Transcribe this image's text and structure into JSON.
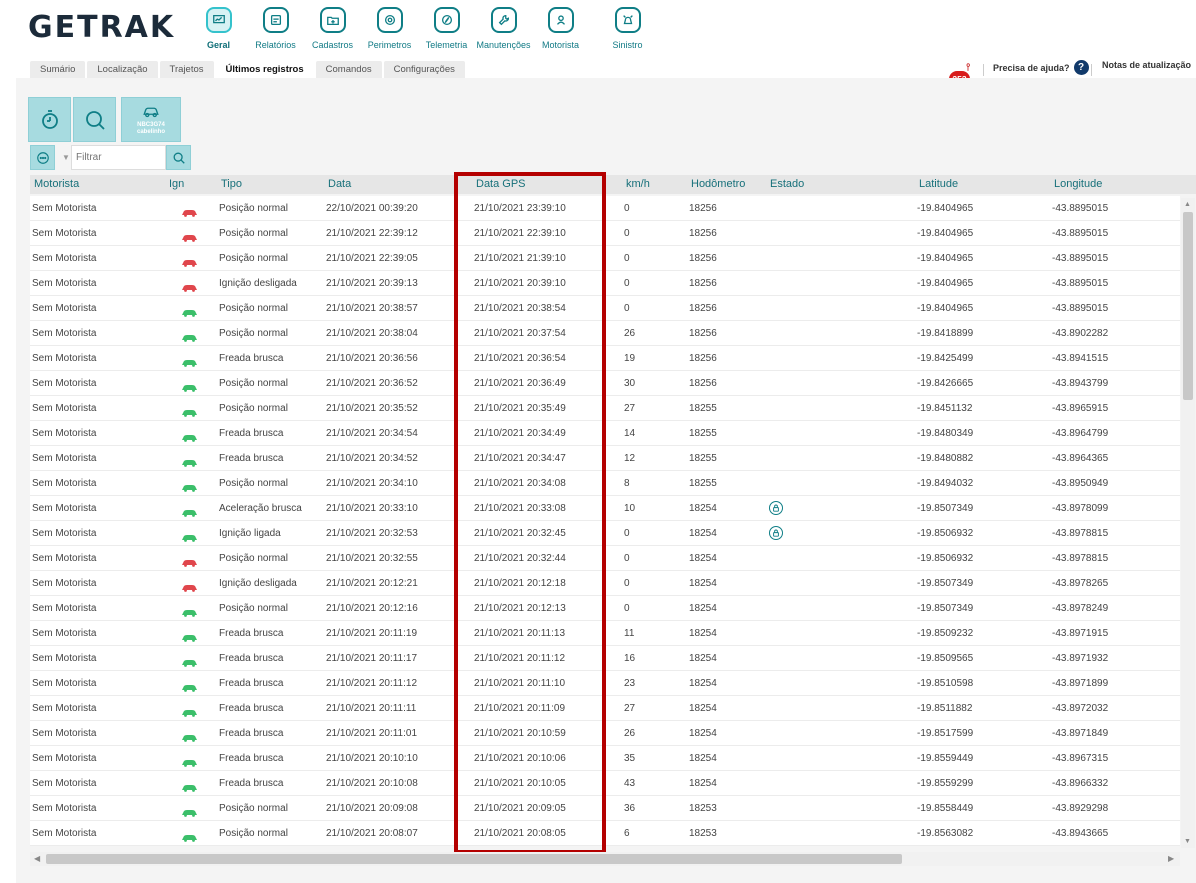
{
  "app": {
    "logo_text": "GETRAK"
  },
  "main_nav": [
    {
      "label": "Geral",
      "icon": "monitor-icon",
      "active": true
    },
    {
      "label": "Relatórios",
      "icon": "report-icon",
      "active": false
    },
    {
      "label": "Cadastros",
      "icon": "folder-plus-icon",
      "active": false
    },
    {
      "label": "Perimetros",
      "icon": "perimeter-icon",
      "active": false
    },
    {
      "label": "Telemetria",
      "icon": "compass-icon",
      "active": false
    },
    {
      "label": "Manutenções",
      "icon": "wrench-icon",
      "active": false
    },
    {
      "label": "Motorista",
      "icon": "driver-icon",
      "active": false
    },
    {
      "label": "Sinistro",
      "icon": "alarm-icon",
      "active": false
    }
  ],
  "sub_tabs": [
    {
      "label": "Sumário",
      "active": false
    },
    {
      "label": "Localização",
      "active": false
    },
    {
      "label": "Trajetos",
      "active": false
    },
    {
      "label": "Últimos registros",
      "active": true
    },
    {
      "label": "Comandos",
      "active": false
    },
    {
      "label": "Configurações",
      "active": false
    }
  ],
  "header_right": {
    "notifications_count": "253",
    "help_label": "Precisa de ajuda?",
    "help_icon_text": "?",
    "release_notes_label": "Notas de atualização"
  },
  "toolbar": {
    "vehicle_label_line1": "NBC3G74",
    "vehicle_label_line2": "cabelinho"
  },
  "filter": {
    "placeholder": "Filtrar"
  },
  "columns": {
    "motorista": "Motorista",
    "ign": "Ign",
    "tipo": "Tipo",
    "data": "Data",
    "data_gps": "Data GPS",
    "kmh": "km/h",
    "hodometro": "Hodômetro",
    "estado": "Estado",
    "latitude": "Latitude",
    "longitude": "Longitude"
  },
  "colors": {
    "ign_on": "#3bbf6a",
    "ign_off": "#e0464c",
    "accent": "#17707a",
    "highlight_box": "#b40000"
  },
  "rows": [
    {
      "motorista": "Sem Motorista",
      "ign": "off",
      "tipo": "Posição normal",
      "data": "22/10/2021 00:39:20",
      "data_gps": "21/10/2021 23:39:10",
      "kmh": "0",
      "hodometro": "18256",
      "estado": "",
      "latitude": "-19.8404965",
      "longitude": "-43.8895015",
      "trail": ""
    },
    {
      "motorista": "Sem Motorista",
      "ign": "off",
      "tipo": "Posição normal",
      "data": "21/10/2021 22:39:12",
      "data_gps": "21/10/2021 22:39:10",
      "kmh": "0",
      "hodometro": "18256",
      "estado": "",
      "latitude": "-19.8404965",
      "longitude": "-43.8895015",
      "trail": ""
    },
    {
      "motorista": "Sem Motorista",
      "ign": "off",
      "tipo": "Posição normal",
      "data": "21/10/2021 22:39:05",
      "data_gps": "21/10/2021 21:39:10",
      "kmh": "0",
      "hodometro": "18256",
      "estado": "",
      "latitude": "-19.8404965",
      "longitude": "-43.8895015",
      "trail": ""
    },
    {
      "motorista": "Sem Motorista",
      "ign": "off",
      "tipo": "Ignição desligada",
      "data": "21/10/2021 20:39:13",
      "data_gps": "21/10/2021 20:39:10",
      "kmh": "0",
      "hodometro": "18256",
      "estado": "",
      "latitude": "-19.8404965",
      "longitude": "-43.8895015",
      "trail": ""
    },
    {
      "motorista": "Sem Motorista",
      "ign": "on",
      "tipo": "Posição normal",
      "data": "21/10/2021 20:38:57",
      "data_gps": "21/10/2021 20:38:54",
      "kmh": "0",
      "hodometro": "18256",
      "estado": "",
      "latitude": "-19.8404965",
      "longitude": "-43.8895015",
      "trail": ""
    },
    {
      "motorista": "Sem Motorista",
      "ign": "on",
      "tipo": "Posição normal",
      "data": "21/10/2021 20:38:04",
      "data_gps": "21/10/2021 20:37:54",
      "kmh": "26",
      "hodometro": "18256",
      "estado": "",
      "latitude": "-19.8418899",
      "longitude": "-43.8902282",
      "trail": ""
    },
    {
      "motorista": "Sem Motorista",
      "ign": "on",
      "tipo": "Freada brusca",
      "data": "21/10/2021 20:36:56",
      "data_gps": "21/10/2021 20:36:54",
      "kmh": "19",
      "hodometro": "18256",
      "estado": "",
      "latitude": "-19.8425499",
      "longitude": "-43.8941515",
      "trail": ""
    },
    {
      "motorista": "Sem Motorista",
      "ign": "on",
      "tipo": "Posição normal",
      "data": "21/10/2021 20:36:52",
      "data_gps": "21/10/2021 20:36:49",
      "kmh": "30",
      "hodometro": "18256",
      "estado": "",
      "latitude": "-19.8426665",
      "longitude": "-43.8943799",
      "trail": ""
    },
    {
      "motorista": "Sem Motorista",
      "ign": "on",
      "tipo": "Posição normal",
      "data": "21/10/2021 20:35:52",
      "data_gps": "21/10/2021 20:35:49",
      "kmh": "27",
      "hodometro": "18255",
      "estado": "",
      "latitude": "-19.8451132",
      "longitude": "-43.8965915",
      "trail": ""
    },
    {
      "motorista": "Sem Motorista",
      "ign": "on",
      "tipo": "Freada brusca",
      "data": "21/10/2021 20:34:54",
      "data_gps": "21/10/2021 20:34:49",
      "kmh": "14",
      "hodometro": "18255",
      "estado": "",
      "latitude": "-19.8480349",
      "longitude": "-43.8964799",
      "trail": ""
    },
    {
      "motorista": "Sem Motorista",
      "ign": "on",
      "tipo": "Freada brusca",
      "data": "21/10/2021 20:34:52",
      "data_gps": "21/10/2021 20:34:47",
      "kmh": "12",
      "hodometro": "18255",
      "estado": "",
      "latitude": "-19.8480882",
      "longitude": "-43.8964365",
      "trail": ""
    },
    {
      "motorista": "Sem Motorista",
      "ign": "on",
      "tipo": "Posição normal",
      "data": "21/10/2021 20:34:10",
      "data_gps": "21/10/2021 20:34:08",
      "kmh": "8",
      "hodometro": "18255",
      "estado": "",
      "latitude": "-19.8494032",
      "longitude": "-43.8950949",
      "trail": ""
    },
    {
      "motorista": "Sem Motorista",
      "ign": "on",
      "tipo": "Aceleração brusca",
      "data": "21/10/2021 20:33:10",
      "data_gps": "21/10/2021 20:33:08",
      "kmh": "10",
      "hodometro": "18254",
      "estado": "lock-icon",
      "latitude": "-19.8507349",
      "longitude": "-43.8978099",
      "trail": ""
    },
    {
      "motorista": "Sem Motorista",
      "ign": "on",
      "tipo": "Ignição ligada",
      "data": "21/10/2021 20:32:53",
      "data_gps": "21/10/2021 20:32:45",
      "kmh": "0",
      "hodometro": "18254",
      "estado": "lock-icon",
      "latitude": "-19.8506932",
      "longitude": "-43.8978815",
      "trail": ""
    },
    {
      "motorista": "Sem Motorista",
      "ign": "off",
      "tipo": "Posição normal",
      "data": "21/10/2021 20:32:55",
      "data_gps": "21/10/2021 20:32:44",
      "kmh": "0",
      "hodometro": "18254",
      "estado": "",
      "latitude": "-19.8506932",
      "longitude": "-43.8978815",
      "trail": ""
    },
    {
      "motorista": "Sem Motorista",
      "ign": "off",
      "tipo": "Ignição desligada",
      "data": "21/10/2021 20:12:21",
      "data_gps": "21/10/2021 20:12:18",
      "kmh": "0",
      "hodometro": "18254",
      "estado": "",
      "latitude": "-19.8507349",
      "longitude": "-43.8978265",
      "trail": ""
    },
    {
      "motorista": "Sem Motorista",
      "ign": "on",
      "tipo": "Posição normal",
      "data": "21/10/2021 20:12:16",
      "data_gps": "21/10/2021 20:12:13",
      "kmh": "0",
      "hodometro": "18254",
      "estado": "",
      "latitude": "-19.8507349",
      "longitude": "-43.8978249",
      "trail": ""
    },
    {
      "motorista": "Sem Motorista",
      "ign": "on",
      "tipo": "Freada brusca",
      "data": "21/10/2021 20:11:19",
      "data_gps": "21/10/2021 20:11:13",
      "kmh": "11",
      "hodometro": "18254",
      "estado": "",
      "latitude": "-19.8509232",
      "longitude": "-43.8971915",
      "trail": ""
    },
    {
      "motorista": "Sem Motorista",
      "ign": "on",
      "tipo": "Freada brusca",
      "data": "21/10/2021 20:11:17",
      "data_gps": "21/10/2021 20:11:12",
      "kmh": "16",
      "hodometro": "18254",
      "estado": "",
      "latitude": "-19.8509565",
      "longitude": "-43.8971932",
      "trail": ""
    },
    {
      "motorista": "Sem Motorista",
      "ign": "on",
      "tipo": "Freada brusca",
      "data": "21/10/2021 20:11:12",
      "data_gps": "21/10/2021 20:11:10",
      "kmh": "23",
      "hodometro": "18254",
      "estado": "",
      "latitude": "-19.8510598",
      "longitude": "-43.8971899",
      "trail": ""
    },
    {
      "motorista": "Sem Motorista",
      "ign": "on",
      "tipo": "Freada brusca",
      "data": "21/10/2021 20:11:11",
      "data_gps": "21/10/2021 20:11:09",
      "kmh": "27",
      "hodometro": "18254",
      "estado": "",
      "latitude": "-19.8511882",
      "longitude": "-43.8972032",
      "trail": ""
    },
    {
      "motorista": "Sem Motorista",
      "ign": "on",
      "tipo": "Freada brusca",
      "data": "21/10/2021 20:11:01",
      "data_gps": "21/10/2021 20:10:59",
      "kmh": "26",
      "hodometro": "18254",
      "estado": "",
      "latitude": "-19.8517599",
      "longitude": "-43.8971849",
      "trail": ""
    },
    {
      "motorista": "Sem Motorista",
      "ign": "on",
      "tipo": "Freada brusca",
      "data": "21/10/2021 20:10:10",
      "data_gps": "21/10/2021 20:10:06",
      "kmh": "35",
      "hodometro": "18254",
      "estado": "",
      "latitude": "-19.8559449",
      "longitude": "-43.8967315",
      "trail": ""
    },
    {
      "motorista": "Sem Motorista",
      "ign": "on",
      "tipo": "Freada brusca",
      "data": "21/10/2021 20:10:08",
      "data_gps": "21/10/2021 20:10:05",
      "kmh": "43",
      "hodometro": "18254",
      "estado": "",
      "latitude": "-19.8559299",
      "longitude": "-43.8966332",
      "trail": ""
    },
    {
      "motorista": "Sem Motorista",
      "ign": "on",
      "tipo": "Posição normal",
      "data": "21/10/2021 20:09:08",
      "data_gps": "21/10/2021 20:09:05",
      "kmh": "36",
      "hodometro": "18253",
      "estado": "",
      "latitude": "-19.8558449",
      "longitude": "-43.8929298",
      "trail": ""
    },
    {
      "motorista": "Sem Motorista",
      "ign": "on",
      "tipo": "Posição normal",
      "data": "21/10/2021 20:08:07",
      "data_gps": "21/10/2021 20:08:05",
      "kmh": "6",
      "hodometro": "18253",
      "estado": "",
      "latitude": "-19.8563082",
      "longitude": "-43.8943665",
      "trail": ""
    }
  ]
}
